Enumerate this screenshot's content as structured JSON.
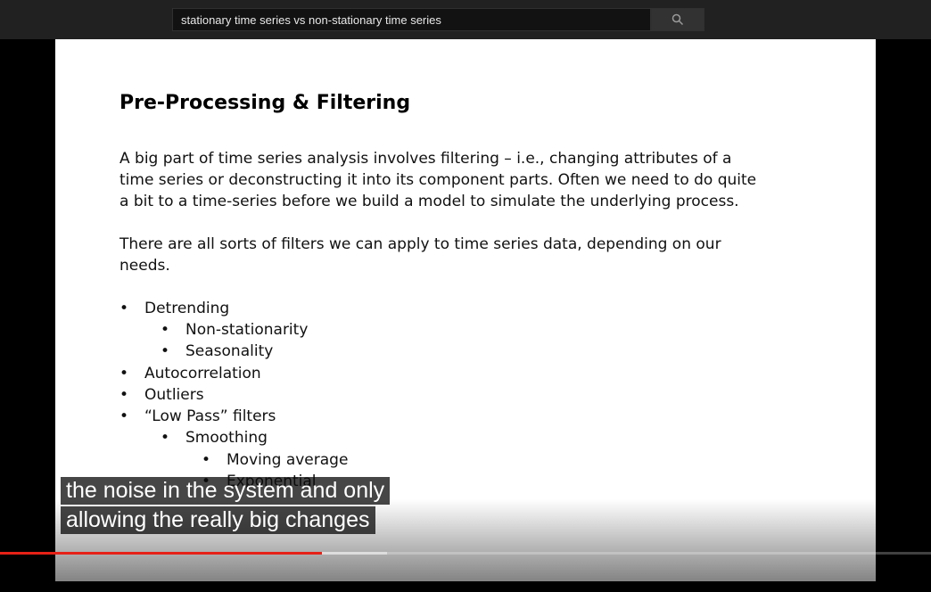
{
  "search": {
    "query": "stationary time series vs non-stationary time series"
  },
  "icons": {
    "search": "search-icon"
  },
  "slide": {
    "title": "Pre-Processing & Filtering",
    "para1": [
      "A big part of time series analysis involves filtering – i.e., changing attributes of a",
      "time series or deconstructing it into its component parts. Often we need to do quite",
      "a bit to a time-series before we build a model to simulate the underlying process."
    ],
    "para2": [
      "There are all sorts of filters we can apply to time series data, depending on our",
      "needs."
    ],
    "bullets": [
      {
        "level": 1,
        "text": "Detrending"
      },
      {
        "level": 2,
        "text": "Non-stationarity"
      },
      {
        "level": 2,
        "text": "Seasonality"
      },
      {
        "level": 1,
        "text": "Autocorrelation"
      },
      {
        "level": 1,
        "text": "Outliers"
      },
      {
        "level": 1,
        "text": "“Low Pass” filters"
      },
      {
        "level": 2,
        "text": "Smoothing"
      },
      {
        "level": 3,
        "text": "Moving average"
      },
      {
        "level": 3,
        "text": "Exponential"
      }
    ],
    "bullet_char": "•"
  },
  "captions": {
    "line1": "the noise in the system and only",
    "line2": "allowing the really big changes"
  },
  "progress": {
    "played_fraction": 0.346,
    "buffered_fraction": 0.416
  },
  "colors": {
    "progress_played": "#e62117",
    "topbar": "#212121"
  }
}
